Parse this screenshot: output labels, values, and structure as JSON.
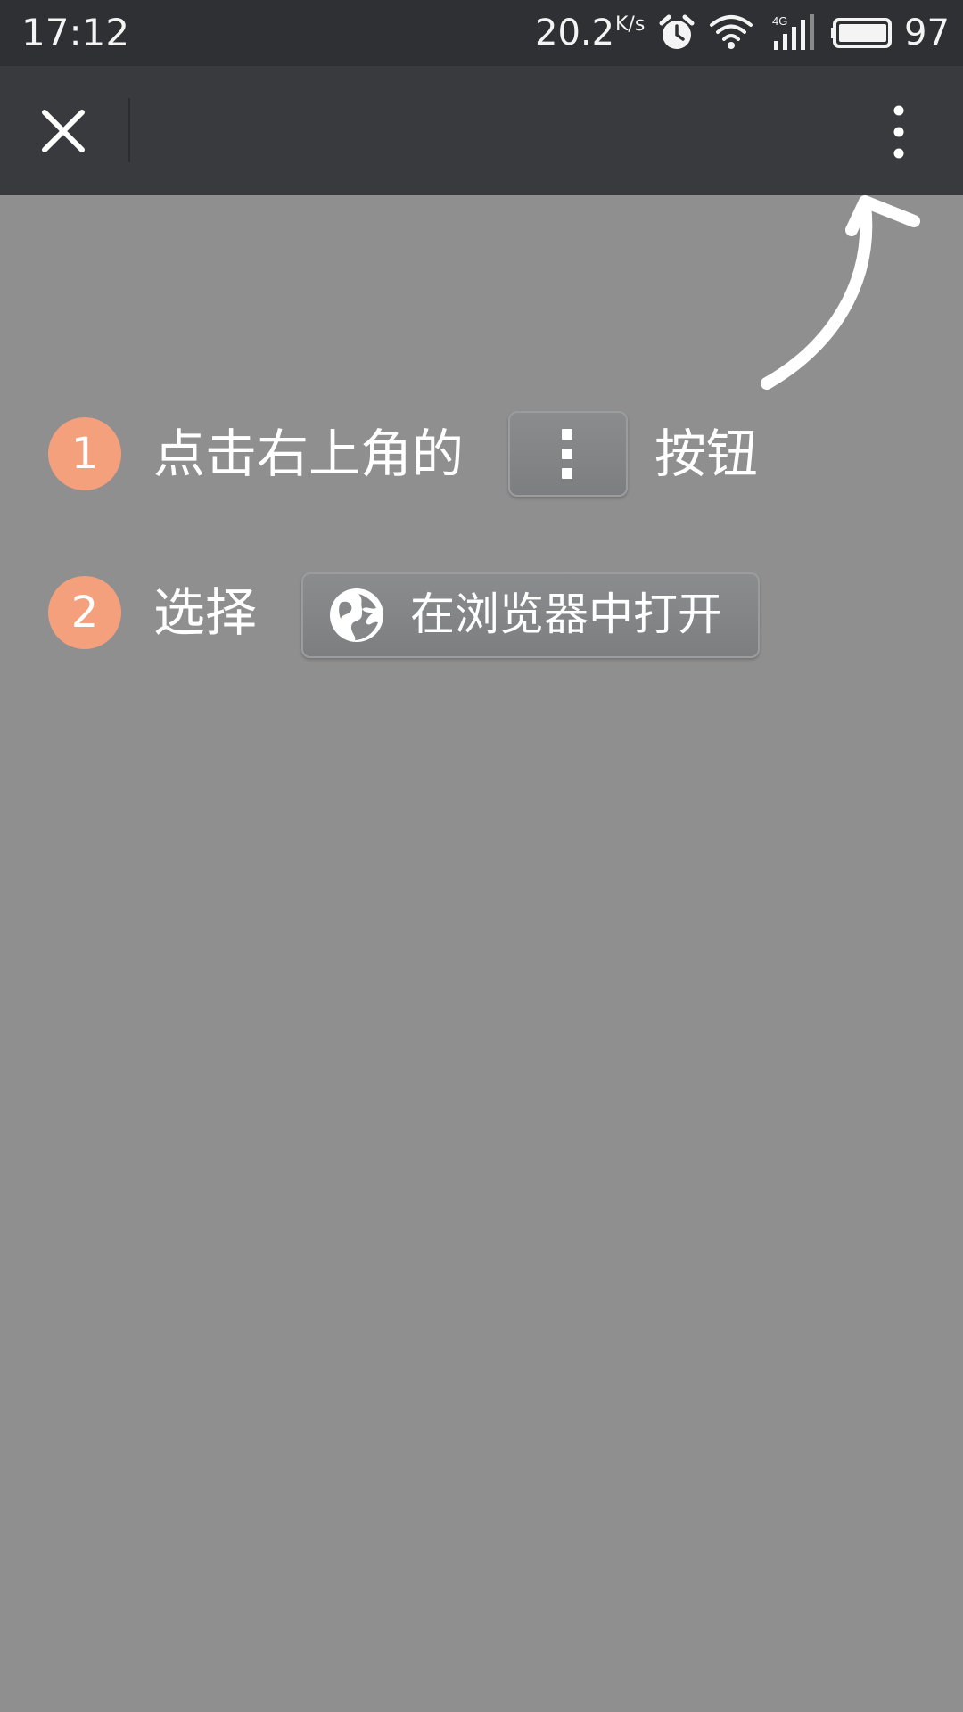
{
  "status_bar": {
    "time": "17:12",
    "net_speed": "20.2",
    "net_speed_unit": "K/s",
    "network_type": "4G",
    "battery_level": "97"
  },
  "app_bar": {
    "close_icon": "close-icon",
    "more_icon": "more-vertical-icon"
  },
  "guide": {
    "step1": {
      "number": "1",
      "text_before": "点击右上角的",
      "text_after": "按钮"
    },
    "step2": {
      "number": "2",
      "text_before": "选择",
      "button_label": "在浏览器中打开"
    }
  },
  "colors": {
    "overlay": "#8f8f8f",
    "badge": "#f4a07d",
    "toolbar": "#393a3d"
  }
}
